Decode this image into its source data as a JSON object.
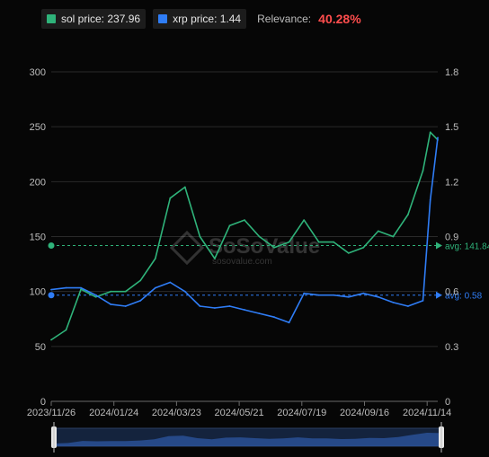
{
  "legend": {
    "series": [
      {
        "label": "sol price: 237.96",
        "color": "#2fb37a"
      },
      {
        "label": "xrp price: 1.44",
        "color": "#2f7df6"
      }
    ],
    "relevance_label": "Relevance:",
    "relevance_value": "40.28%",
    "relevance_color": "#ff4d4d"
  },
  "watermark": {
    "brand": "SoSoValue",
    "url": "sosovalue.com"
  },
  "annotations": {
    "sol_avg": "avg: 141.84",
    "xrp_avg": "avg: 0.58"
  },
  "chart_data": {
    "type": "line",
    "x": [
      "2023-11-26",
      "2023-12-10",
      "2023-12-24",
      "2024-01-07",
      "2024-01-21",
      "2024-02-04",
      "2024-02-18",
      "2024-03-03",
      "2024-03-17",
      "2024-03-31",
      "2024-04-14",
      "2024-04-28",
      "2024-05-12",
      "2024-05-26",
      "2024-06-09",
      "2024-06-23",
      "2024-07-07",
      "2024-07-21",
      "2024-08-04",
      "2024-08-18",
      "2024-09-01",
      "2024-09-15",
      "2024-09-29",
      "2024-10-13",
      "2024-10-27",
      "2024-11-10",
      "2024-11-17",
      "2024-11-24"
    ],
    "x_tick_labels": [
      "2023/11/26",
      "2024/01/24",
      "2024/03/23",
      "2024/05/21",
      "2024/07/19",
      "2024/09/16",
      "2024/11/14"
    ],
    "series": [
      {
        "name": "sol price",
        "axis": "left",
        "color": "#2fb37a",
        "values": [
          56,
          65,
          102,
          95,
          100,
          100,
          110,
          130,
          185,
          195,
          150,
          130,
          160,
          165,
          150,
          140,
          145,
          165,
          145,
          145,
          135,
          140,
          155,
          150,
          170,
          210,
          245,
          238
        ]
      },
      {
        "name": "xrp price",
        "axis": "right",
        "color": "#2f7df6",
        "values": [
          0.61,
          0.62,
          0.62,
          0.58,
          0.53,
          0.52,
          0.55,
          0.62,
          0.65,
          0.6,
          0.52,
          0.51,
          0.52,
          0.5,
          0.48,
          0.46,
          0.43,
          0.59,
          0.58,
          0.58,
          0.57,
          0.59,
          0.57,
          0.54,
          0.52,
          0.55,
          1.1,
          1.44
        ]
      }
    ],
    "y_left": {
      "ticks": [
        0,
        50,
        100,
        150,
        200,
        250,
        300
      ],
      "ylim": [
        0,
        300
      ]
    },
    "y_right": {
      "ticks": [
        0,
        0.3,
        0.6,
        0.9,
        1.2,
        1.5,
        1.8
      ],
      "ylim": [
        0,
        1.8
      ]
    },
    "averages": {
      "sol": 141.84,
      "xrp": 0.58
    },
    "grid": true
  }
}
